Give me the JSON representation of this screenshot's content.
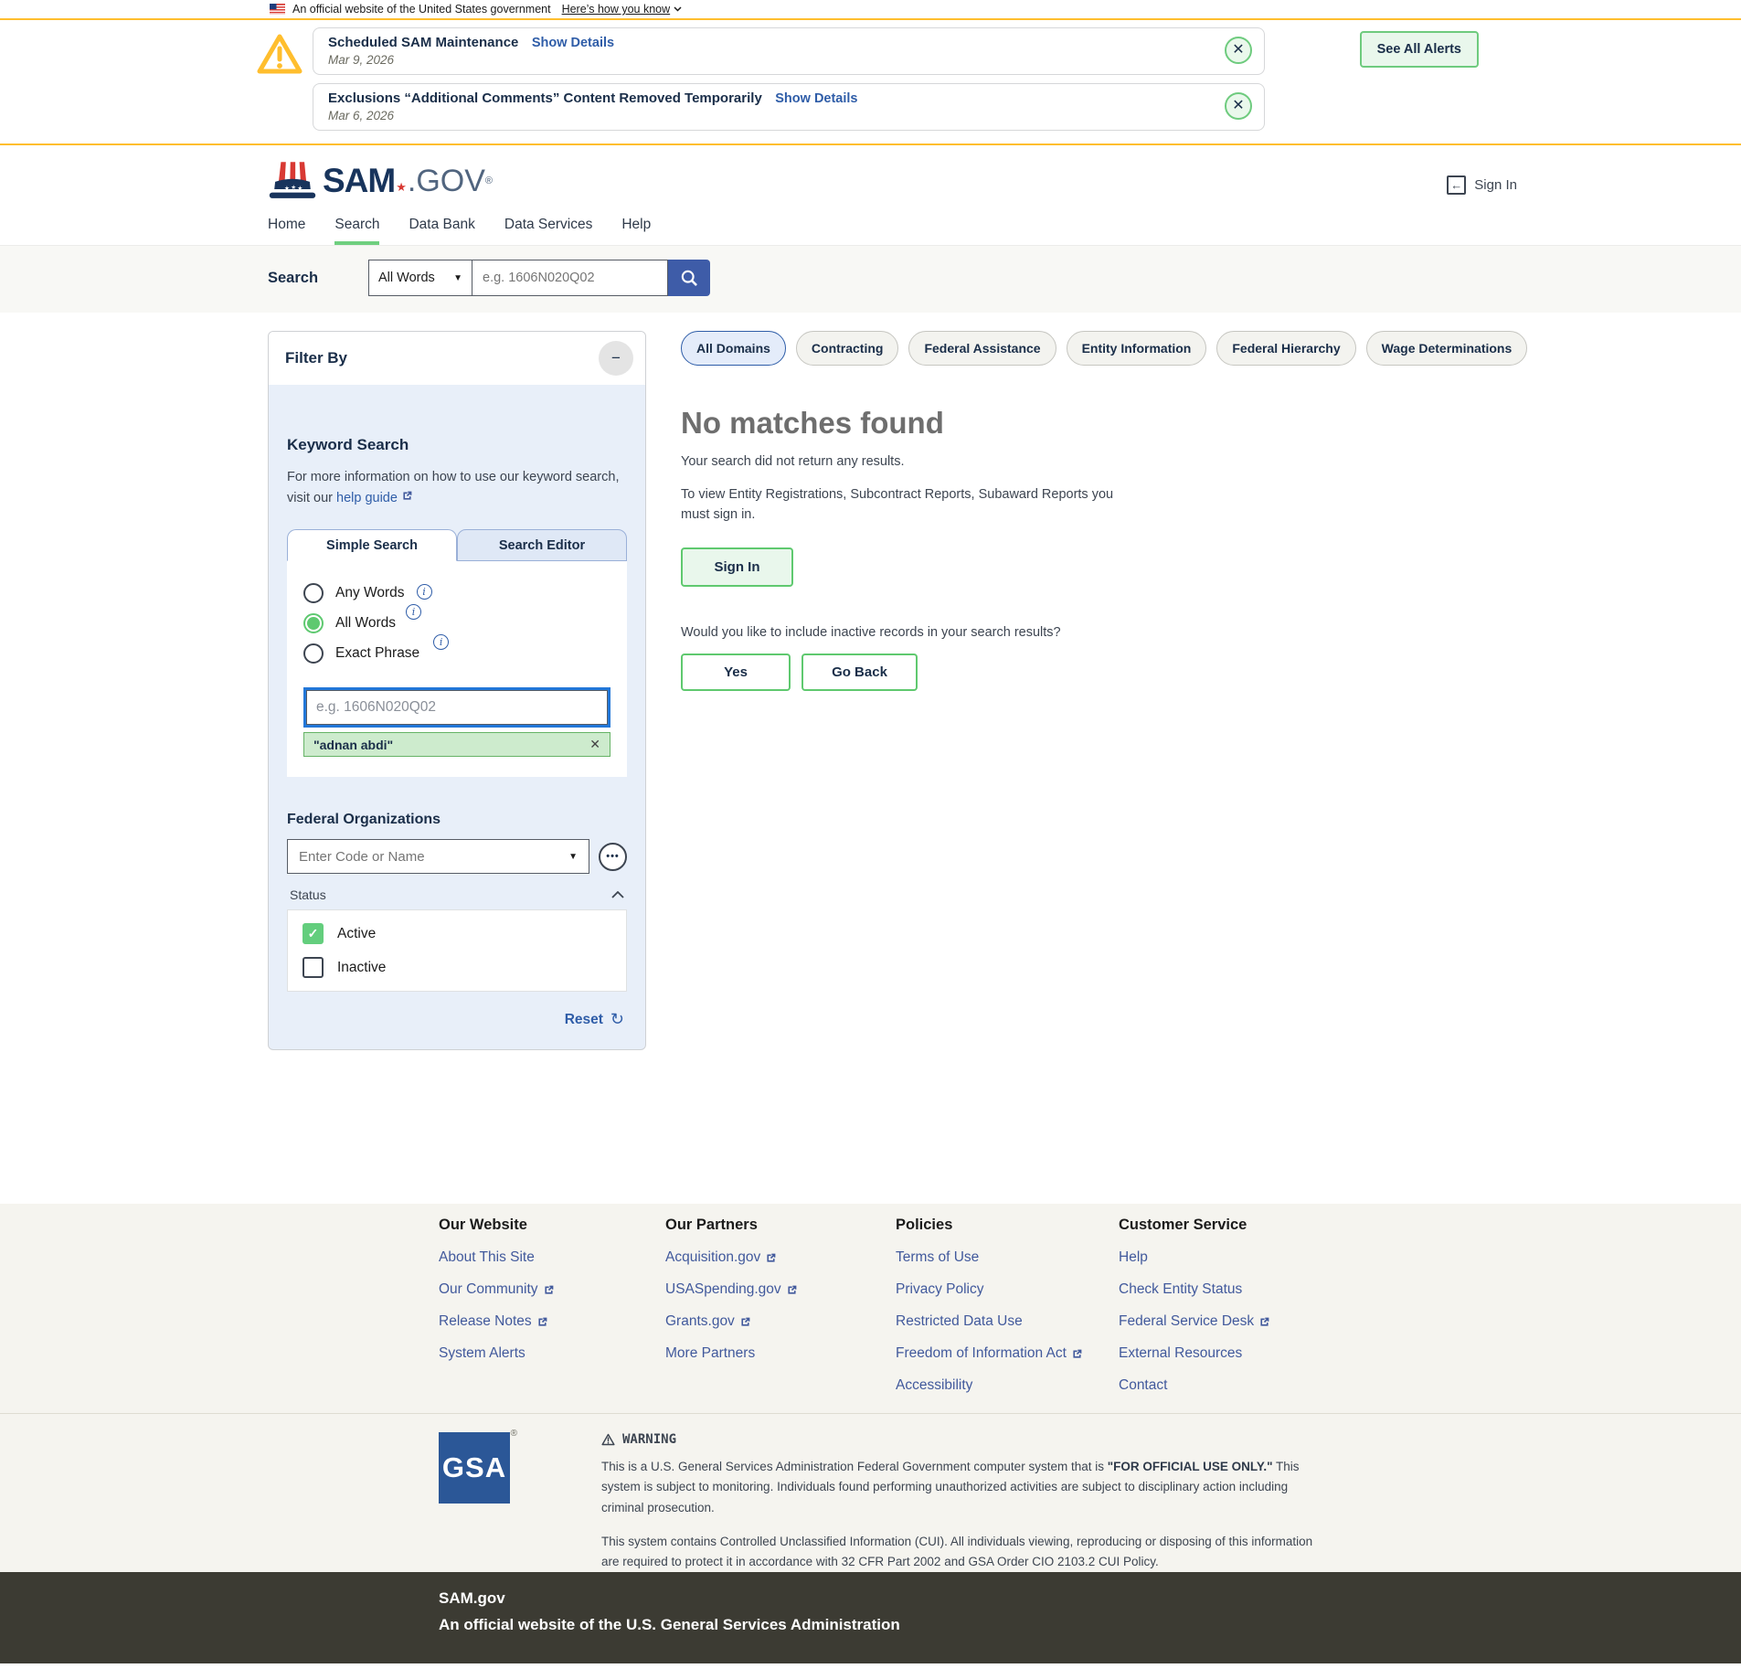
{
  "banner": {
    "text": "An official website of the United States government",
    "link": "Here’s how you know"
  },
  "alerts": {
    "items": [
      {
        "title": "Scheduled SAM Maintenance",
        "link": "Show Details",
        "date": "Mar 9, 2026"
      },
      {
        "title": "Exclusions “Additional Comments” Content Removed Temporarily",
        "link": "Show Details",
        "date": "Mar 6, 2026"
      }
    ],
    "see_all": "See All Alerts"
  },
  "header": {
    "logo_sam": "SAM",
    "logo_gov": ".GOV",
    "logo_reg": "®",
    "sign_in": "Sign In"
  },
  "nav": {
    "items": [
      {
        "label": "Home"
      },
      {
        "label": "Search"
      },
      {
        "label": "Data Bank"
      },
      {
        "label": "Data Services"
      },
      {
        "label": "Help"
      }
    ],
    "active": "Search"
  },
  "searchbar": {
    "label": "Search",
    "mode": "All Words",
    "placeholder": "e.g. 1606N020Q02"
  },
  "filter": {
    "title": "Filter By",
    "keyword": {
      "heading": "Keyword Search",
      "info_text": "For more information on how to use our keyword search, visit our",
      "help_link": "help guide",
      "tabs": [
        "Simple Search",
        "Search Editor"
      ],
      "active_tab": "Simple Search",
      "options": [
        "Any Words",
        "All Words",
        "Exact Phrase"
      ],
      "selected_option": "All Words",
      "input_placeholder": "e.g. 1606N020Q02",
      "input_value": "",
      "tag": "\"adnan abdi\""
    },
    "federal_org": {
      "heading": "Federal Organizations",
      "placeholder": "Enter Code or Name"
    },
    "status": {
      "heading": "Status",
      "options": [
        {
          "label": "Active",
          "checked": true
        },
        {
          "label": "Inactive",
          "checked": false
        }
      ]
    },
    "reset": "Reset"
  },
  "results": {
    "domains": [
      "All Domains",
      "Contracting",
      "Federal Assistance",
      "Entity Information",
      "Federal Hierarchy",
      "Wage Determinations"
    ],
    "active_domain": "All Domains",
    "no_match_title": "No matches found",
    "no_match_sub": "Your search did not return any results.",
    "signin_note": "To view Entity Registrations, Subcontract Reports, Subaward Reports you must sign in.",
    "sign_in_button": "Sign In",
    "inactive_question": "Would you like to include inactive records in your search results?",
    "yes_button": "Yes",
    "go_back_button": "Go Back"
  },
  "footer": {
    "columns": [
      {
        "heading": "Our Website",
        "links": [
          {
            "label": "About This Site",
            "external": false
          },
          {
            "label": "Our Community",
            "external": true
          },
          {
            "label": "Release Notes",
            "external": true
          },
          {
            "label": "System Alerts",
            "external": false
          }
        ]
      },
      {
        "heading": "Our Partners",
        "links": [
          {
            "label": "Acquisition.gov",
            "external": true
          },
          {
            "label": "USASpending.gov",
            "external": true
          },
          {
            "label": "Grants.gov",
            "external": true
          },
          {
            "label": "More Partners",
            "external": false
          }
        ]
      },
      {
        "heading": "Policies",
        "links": [
          {
            "label": "Terms of Use",
            "external": false
          },
          {
            "label": "Privacy Policy",
            "external": false
          },
          {
            "label": "Restricted Data Use",
            "external": false
          },
          {
            "label": "Freedom of Information Act",
            "external": true
          },
          {
            "label": "Accessibility",
            "external": false
          }
        ]
      },
      {
        "heading": "Customer Service",
        "links": [
          {
            "label": "Help",
            "external": false
          },
          {
            "label": "Check Entity Status",
            "external": false
          },
          {
            "label": "Federal Service Desk",
            "external": true
          },
          {
            "label": "External Resources",
            "external": false
          },
          {
            "label": "Contact",
            "external": false
          }
        ]
      }
    ],
    "gsa": "GSA",
    "gsa_reg": "®",
    "warning_title": "WARNING",
    "warning_p1_a": "This is a U.S. General Services Administration Federal Government computer system that is ",
    "warning_p1_b": "\"FOR OFFICIAL USE ONLY.\"",
    "warning_p1_c": " This system is subject to monitoring. Individuals found performing unauthorized activities are subject to disciplinary action including criminal prosecution.",
    "warning_p2": "This system contains Controlled Unclassified Information (CUI). All individuals viewing, reproducing or disposing of this information are required to protect it in accordance with 32 CFR Part 2002 and GSA Order CIO 2103.2 CUI Policy.",
    "site": "SAM.gov",
    "tagline": "An official website of the U.S. General Services Administration"
  },
  "colors": {
    "accent_gold": "#ffbe2e",
    "green": "#5fc96f",
    "link_blue": "#2f5da8",
    "primary_blue": "#3e5ca8",
    "footer_dark": "#3c3b33"
  }
}
